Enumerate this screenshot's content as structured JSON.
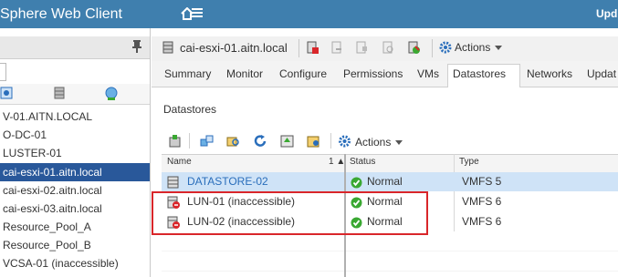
{
  "header": {
    "app_title": "vSphere Web Client",
    "user_text": "Upd"
  },
  "navigator": {
    "tree": [
      {
        "label": "V-01.AITN.LOCAL"
      },
      {
        "label": "O-DC-01"
      },
      {
        "label": "LUSTER-01"
      },
      {
        "label": "cai-esxi-01.aitn.local",
        "selected": true
      },
      {
        "label": "cai-esxi-02.aitn.local"
      },
      {
        "label": "cai-esxi-03.aitn.local"
      },
      {
        "label": "Resource_Pool_A"
      },
      {
        "label": "Resource_Pool_B"
      },
      {
        "label": "VCSA-01 (inaccessible)"
      }
    ]
  },
  "object": {
    "title": "cai-esxi-01.aitn.local",
    "actions_label": "Actions"
  },
  "tabs": [
    "Summary",
    "Monitor",
    "Configure",
    "Permissions",
    "VMs",
    "Datastores",
    "Networks",
    "Updat"
  ],
  "active_tab": "Datastores",
  "section": {
    "title": "Datastores",
    "actions_label": "Actions"
  },
  "grid": {
    "columns": {
      "name": "Name",
      "sort": "1 ▲",
      "status": "Status",
      "type": "Type"
    },
    "rows": [
      {
        "name": "DATASTORE-02",
        "status": "Normal",
        "type": "VMFS 5",
        "state": "ok",
        "selected": true
      },
      {
        "name": "LUN-01 (inaccessible)",
        "status": "Normal",
        "type": "VMFS 6",
        "state": "error"
      },
      {
        "name": "LUN-02 (inaccessible)",
        "status": "Normal",
        "type": "VMFS 6",
        "state": "error"
      }
    ]
  },
  "colors": {
    "header": "#3f7fae",
    "selected_tree": "#29589a",
    "selected_row": "#cfe3f7",
    "highlight": "#d9262a",
    "ok": "#3aa832"
  }
}
